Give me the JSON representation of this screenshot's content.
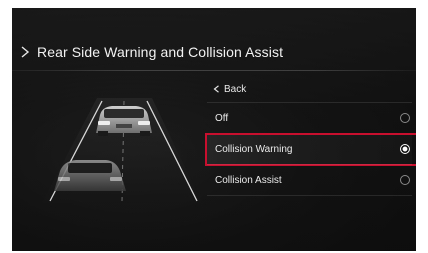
{
  "header": {
    "title": "Rear Side Warning and Collision Assist"
  },
  "menu": {
    "back_label": "Back",
    "options": [
      {
        "label": "Off",
        "selected": false
      },
      {
        "label": "Collision Warning",
        "selected": true
      },
      {
        "label": "Collision Assist",
        "selected": false
      }
    ]
  },
  "colors": {
    "highlight": "#c8102e",
    "background": "#111111",
    "text": "#ececec"
  },
  "icons": {
    "title": "chevron-right-icon",
    "back": "chevron-left-icon",
    "illustration": "rear-cars-on-road-illustration"
  }
}
